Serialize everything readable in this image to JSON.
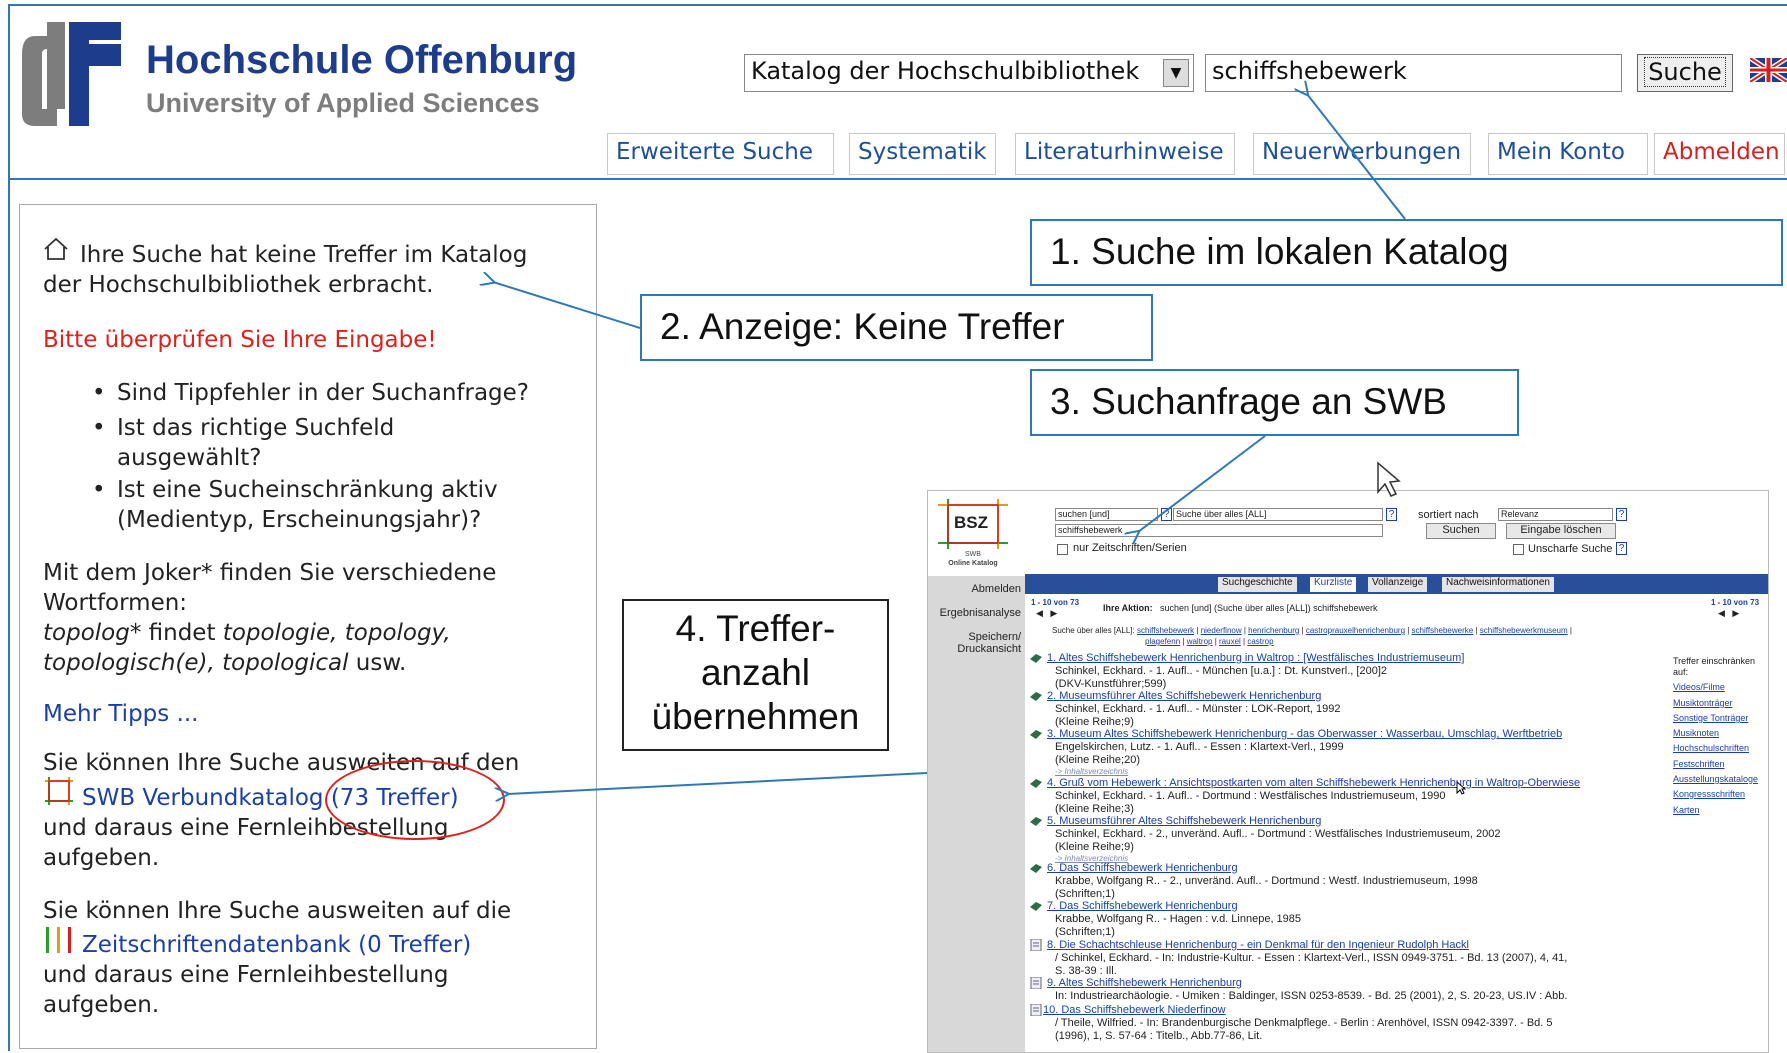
{
  "brand": {
    "name": "Hochschule Offenburg",
    "subtitle": "University of Applied Sciences",
    "colors": {
      "blue": "#1e3c8c",
      "grey": "#7d7d7d",
      "accent": "#2f78b7",
      "red": "#e0201c"
    }
  },
  "search": {
    "catalog": "Katalog der Hochschulbibliothek",
    "query": "schiffshebewerk",
    "button": "Suche"
  },
  "nav": {
    "tabs": [
      "Erweiterte Suche",
      "Systematik",
      "Literaturhinweise",
      "Neuerwerbungen",
      "Mein Konto",
      "Abmelden"
    ]
  },
  "result": {
    "no_hits_line1": "Ihre Suche hat keine Treffer im Katalog",
    "no_hits_line2": "der Hochschulbibliothek erbracht.",
    "check_input": "Bitte überprüfen Sie Ihre Eingabe!",
    "bullets": [
      [
        "Sind Tippfehler in der Suchanfrage?"
      ],
      [
        "Ist das richtige Suchfeld",
        "ausgewählt?"
      ],
      [
        "Ist eine Sucheinschränkung aktiv",
        "(Medientyp, Erscheinungsjahr)?"
      ]
    ],
    "joker_line1": "Mit dem Joker* finden Sie verschiedene",
    "joker_line2": "Wortformen:",
    "joker_ex1_a": "topolog*",
    "joker_ex1_b": " findet ",
    "joker_ex1_c": "topologie, topology,",
    "joker_ex2_a": "topologisch(e), topological",
    "joker_ex2_b": " usw.",
    "more_tips": "Mehr Tipps ...",
    "swb_intro": "Sie können Ihre Suche ausweiten auf den",
    "swb_link": "SWB Verbundkatalog (73 Treffer)",
    "swb_after1": "und daraus eine Fernleihbestellung",
    "swb_after2": "aufgeben.",
    "zdb_intro": "Sie können Ihre Suche ausweiten auf die",
    "zdb_link": "Zeitschriftendatenbank (0 Treffer)",
    "zdb_after1": "und daraus eine Fernleihbestellung",
    "zdb_after2": "aufgeben."
  },
  "callouts": {
    "c1": "1. Suche im lokalen Katalog",
    "c2": "2. Anzeige: Keine Treffer",
    "c3": "3. Suchanfrage an SWB",
    "c4_l1": "4. Treffer-",
    "c4_l2": "anzahl",
    "c4_l3": "übernehmen"
  },
  "swb": {
    "logo": "BSZ",
    "logo_sub1": "SWB",
    "logo_sub2": "Online Katalog",
    "sel1": "suchen [und]",
    "sel2": "Suche über alles [ALL]",
    "sort_label": "sortiert nach",
    "sort_value": "Relevanz",
    "query": "schiffshebewerk",
    "btn_search": "Suchen",
    "btn_clear": "Eingabe löschen",
    "only_journals": "nur Zeitschriften/Serien",
    "fuzzy": "Unscharfe Suche",
    "tabs": [
      "Suchgeschichte",
      "Kurzliste",
      "Vollanzeige",
      "Nachweisinformationen"
    ],
    "side": [
      "Abmelden",
      "Ergebnisanalyse",
      "Speichern/",
      "Druckansicht"
    ],
    "range": "1 - 10 von 73",
    "action_label": "Ihre Aktion:",
    "action_text": "suchen [und] (Suche über alles [ALL]) schiffshebewerk",
    "related_label": "Suche über alles [ALL]:",
    "related": [
      "schiffshebewerk",
      "niederfinow",
      "henrichenburg",
      "castroprauxelhenrichenburg",
      "schiffshebewerke",
      "schiffshebewerkmuseum"
    ],
    "related2": [
      "plagefenn",
      "waltrop",
      "rauxel",
      "castrop"
    ],
    "filter_title1": "Treffer einschränken",
    "filter_title2": "auf:",
    "filters": [
      "Videos/Filme",
      "Musiktonträger",
      "Sonstige Tonträger",
      "Musiknoten",
      "Hochschulschriften",
      "Festschriften",
      "Ausstellungskataloge",
      "Kongressschriften",
      "Karten"
    ],
    "toc": "-> Inhaltsverzeichnis",
    "results": [
      {
        "title": "1. Altes Schiffshebewerk Henrichenburg in Waltrop : [Westfälisches Industriemuseum]",
        "lines": [
          "Schinkel, Eckhard. - 1. Aufl.. - München [u.a.] : Dt. Kunstverl., [200]2",
          "(DKV-Kunstführer;599)"
        ],
        "toc": false
      },
      {
        "title": "2. Museumsführer Altes Schiffshebewerk Henrichenburg",
        "lines": [
          "Schinkel, Eckhard. - 1. Aufl.. - Münster : LOK-Report, 1992",
          "(Kleine Reihe;9)"
        ],
        "toc": false
      },
      {
        "title": "3. Museum Altes Schiffshebewerk Henrichenburg - das Oberwasser : Wasserbau, Umschlag, Werftbetrieb",
        "lines": [
          "Engelskirchen, Lutz. - 1. Aufl.. - Essen : Klartext-Verl., 1999",
          "(Kleine Reihe;20)"
        ],
        "toc": true
      },
      {
        "title": "4. Gruß vom Hebewerk : Ansichtspostkarten vom alten Schiffshebewerk Henrichenburg in Waltrop-Oberwiese",
        "lines": [
          "Schinkel, Eckhard. - 1. Aufl.. - Dortmund : Westfälisches Industriemuseum, 1990",
          "(Kleine Reihe;3)"
        ],
        "toc": false
      },
      {
        "title": "5. Museumsführer Altes Schiffshebewerk Henrichenburg",
        "lines": [
          "Schinkel, Eckhard. - 2., unveränd. Aufl.. - Dortmund : Westfälisches Industriemuseum, 2002",
          "(Kleine Reihe;9)"
        ],
        "toc": true
      },
      {
        "title": "6. Das Schiffshebewerk Henrichenburg",
        "lines": [
          "Krabbe, Wolfgang R.. - 2., unveränd. Aufl.. - Dortmund : Westf. Industriemuseum, 1998",
          "(Schriften;1)"
        ],
        "toc": false
      },
      {
        "title": "7. Das Schiffshebewerk Henrichenburg",
        "lines": [
          "Krabbe, Wolfgang R.. - Hagen : v.d. Linnepe, 1985",
          "(Schriften;1)"
        ],
        "toc": false
      },
      {
        "title": "8. Die Schachtschleuse Henrichenburg - ein Denkmal für den Ingenieur Rudolph Hackl",
        "lines": [
          "/ Schinkel, Eckhard. - In: Industrie-Kultur. - Essen : Klartext-Verl., ISSN 0949-3751. - Bd. 13 (2007), 4, 41,",
          "S. 38-39 : Ill."
        ],
        "toc": false
      },
      {
        "title": "9. Altes Schiffshebewerk Henrichenburg",
        "lines": [
          "In: Industriearchäologie. - Umiken : Baldinger, ISSN 0253-8539. - Bd. 25 (2001), 2, S. 20-23, US.IV : Abb."
        ],
        "toc": false
      },
      {
        "title": "10. Das Schiffshebewerk Niederfinow",
        "lines": [
          "/ Theile, Wilfried. - In: Brandenburgische Denkmalpflege. - Berlin : Arenhövel, ISSN 0942-3397. - Bd. 5",
          "(1996), 1, S. 57-64 : Titelb., Abb.77-86, Lit."
        ],
        "toc": false
      }
    ]
  }
}
